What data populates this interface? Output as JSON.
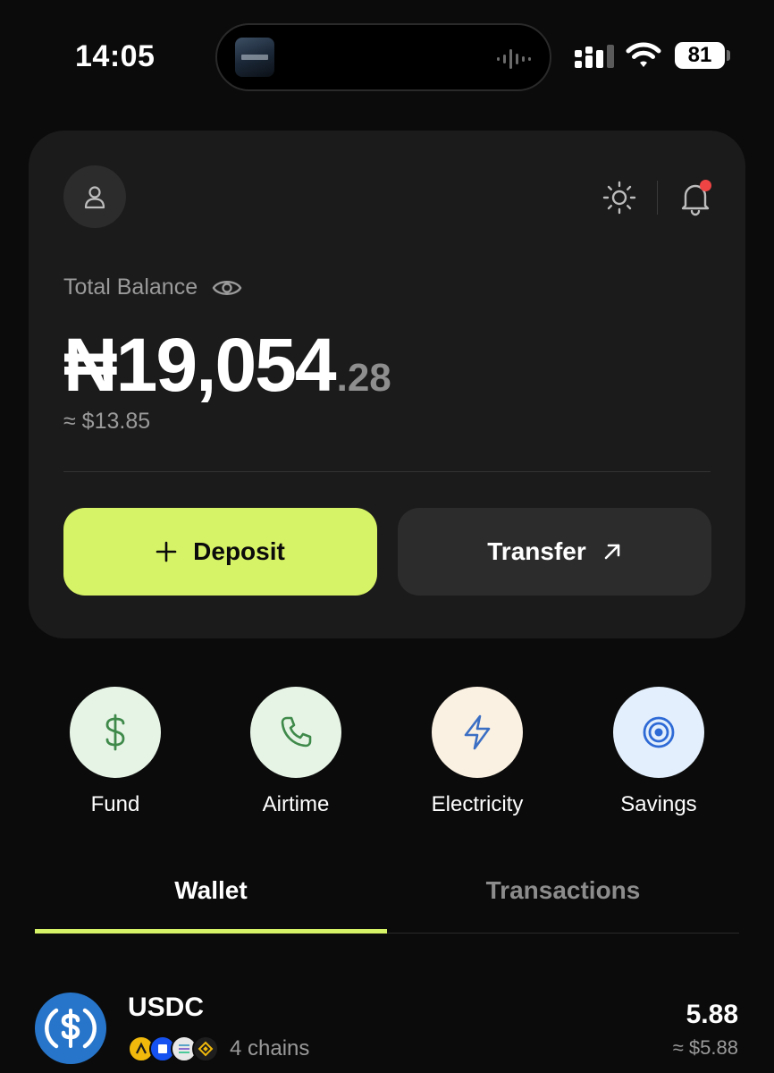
{
  "status_bar": {
    "time": "14:05",
    "battery": "81",
    "icons": [
      "signal-icon",
      "wifi-icon",
      "battery-icon"
    ]
  },
  "card": {
    "balance_label": "Total Balance",
    "balance_currency": "₦",
    "balance_whole": "19,054",
    "balance_decimal": ".28",
    "balance_usd": "≈ $13.85",
    "deposit_label": "Deposit",
    "transfer_label": "Transfer"
  },
  "quick_actions": [
    {
      "label": "Fund",
      "icon": "dollar-icon",
      "bg": "#e6f4e6",
      "color": "#3f8a4a"
    },
    {
      "label": "Airtime",
      "icon": "phone-icon",
      "bg": "#e6f4e6",
      "color": "#3f8a4a"
    },
    {
      "label": "Electricity",
      "icon": "lightning-icon",
      "bg": "#fbf1e2",
      "color": "#3b6fc4"
    },
    {
      "label": "Savings",
      "icon": "target-icon",
      "bg": "#e3effc",
      "color": "#2e6ad6"
    }
  ],
  "tabs": {
    "wallet": "Wallet",
    "transactions": "Transactions",
    "active": "wallet"
  },
  "assets": [
    {
      "symbol": "USDC",
      "chains": "4 chains",
      "amount": "5.88",
      "usd": "≈ $5.88",
      "icon_color": "#2775ca"
    }
  ],
  "colors": {
    "accent": "#d6f266",
    "background": "#0b0b0b",
    "card": "#1b1b1b",
    "notification_dot": "#ef4444"
  }
}
